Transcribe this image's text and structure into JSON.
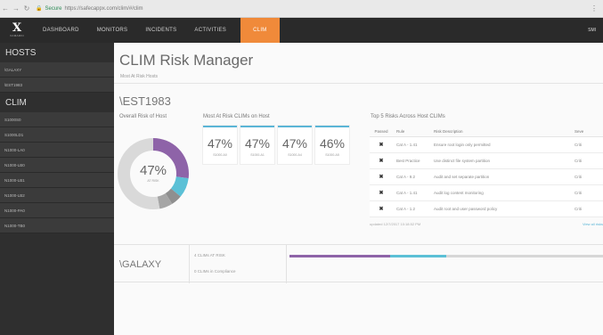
{
  "browser": {
    "secure_label": "Secure",
    "url": "https://safecappx.com/clim/#/clim"
  },
  "topnav": {
    "logo_mark": "X",
    "logo_sub": "XAMARIN",
    "items": [
      "DASHBOARD",
      "MONITORS",
      "INCIDENTS",
      "ACTIVITIES",
      "CLIM"
    ],
    "active": "CLIM",
    "right_label": "SMI"
  },
  "sidebar": {
    "hosts_heading": "HOSTS",
    "hosts": [
      "\\GALAXY",
      "\\EST1983"
    ],
    "clim_heading": "CLIM",
    "clims": [
      "S1000S0",
      "S1000LD1",
      "N1000-LA0",
      "N1000-LB0",
      "N1000-LB1",
      "N1000-LB2",
      "N1000-PA0",
      "N1000-TB0"
    ]
  },
  "main": {
    "title": "CLIM Risk Manager",
    "breadcrumb": "Most At Risk Hosts",
    "host": "\\EST1983",
    "overall_label": "Overall Risk of Host",
    "overall_value": "47%",
    "overall_sub": "AT RISK",
    "clims_label": "Most At Risk CLIMs on Host",
    "cards": [
      {
        "value": "47%",
        "name": "S1000-A0"
      },
      {
        "value": "47%",
        "name": "S1000-A1"
      },
      {
        "value": "47%",
        "name": "S1000-A4"
      },
      {
        "value": "46%",
        "name": "S1000-A5"
      }
    ],
    "risks_label": "Top 5 Risks Across Host CLIMs",
    "risks_headers": {
      "passed": "Passed",
      "rule": "Rule",
      "desc": "Risk Description",
      "sev": "Seve"
    },
    "risks": [
      {
        "passed": "✖",
        "rule": "Cat A - 1.41",
        "desc": "Ensure root login only permitted",
        "sev": "Criti"
      },
      {
        "passed": "✖",
        "rule": "Best Practice",
        "desc": "Use distinct file system partition",
        "sev": "Criti"
      },
      {
        "passed": "✖",
        "rule": "Cat A - 9.2",
        "desc": "Audit and set separate partition",
        "sev": "Criti"
      },
      {
        "passed": "✖",
        "rule": "Cat A - 1.41",
        "desc": "Audit log content monitoring",
        "sev": "Criti"
      },
      {
        "passed": "✖",
        "rule": "Cat A - 1.2",
        "desc": "Audit root and user password policy",
        "sev": "Criti"
      }
    ],
    "risks_updated": "updated 12/7/2017 10:18:52 PM",
    "risks_view_all": "View all risks",
    "donut": {
      "segments": [
        {
          "value": 27,
          "color": "#8e63a8"
        },
        {
          "value": 9,
          "color": "#5bc0d6"
        },
        {
          "value": 5,
          "color": "#8f8f8f"
        },
        {
          "value": 6,
          "color": "#a6a6a6"
        },
        {
          "value": 53,
          "color": "#d9d9d9"
        }
      ]
    },
    "host2": "\\GALAXY",
    "host2_meta1": "4 CLIMs AT RISK",
    "host2_meta2": "0 CLIMs in Compliance",
    "progress": [
      {
        "value": 0.32,
        "color": "#8e63a8"
      },
      {
        "value": 0.18,
        "color": "#5bc0d6"
      },
      {
        "value": 0.5,
        "color": "#d7d7d7"
      }
    ]
  }
}
